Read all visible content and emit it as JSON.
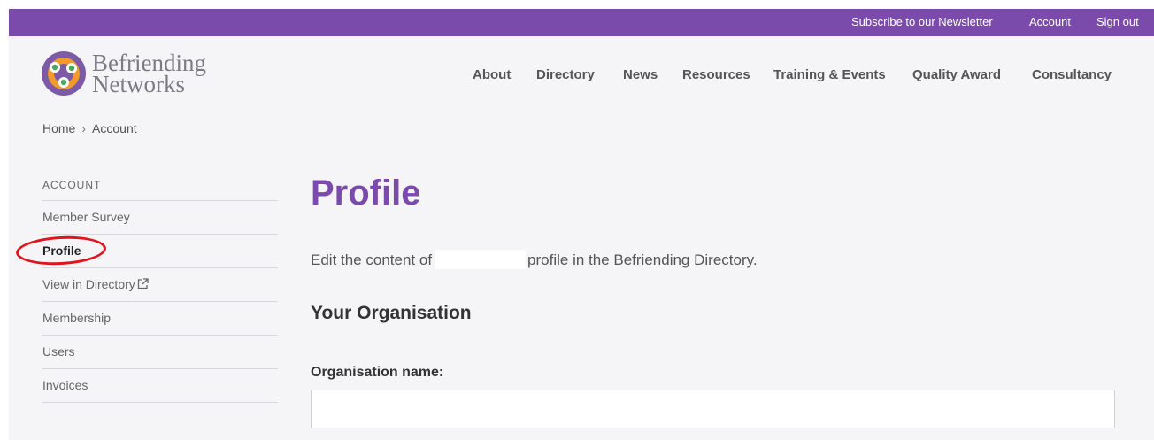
{
  "topbar": {
    "links": [
      "Subscribe to our Newsletter",
      "Account",
      "Sign out"
    ],
    "color": "#7b4bab"
  },
  "logo": {
    "line1": "Befriending",
    "line2": "Networks",
    "icon": "befriending-networks-logo-icon"
  },
  "nav": {
    "items": [
      "About",
      "Directory",
      "News",
      "Resources",
      "Training & Events",
      "Quality Award",
      "Consultancy"
    ]
  },
  "breadcrumb": {
    "home": "Home",
    "separator": "›",
    "current": "Account"
  },
  "sidebar": {
    "heading": "ACCOUNT",
    "items": [
      "Member Survey",
      "Profile",
      "View in Directory",
      "Membership",
      "Users",
      "Invoices"
    ],
    "active": "Profile",
    "external_icon": "external-link-icon"
  },
  "main": {
    "title": "Profile",
    "intro_before": "Edit the content of",
    "intro_after": "profile in the Befriending Directory.",
    "section_title": "Your Organisation",
    "field_label": "Organisation name:",
    "field_value": "",
    "accent_color": "#7b4bab"
  }
}
